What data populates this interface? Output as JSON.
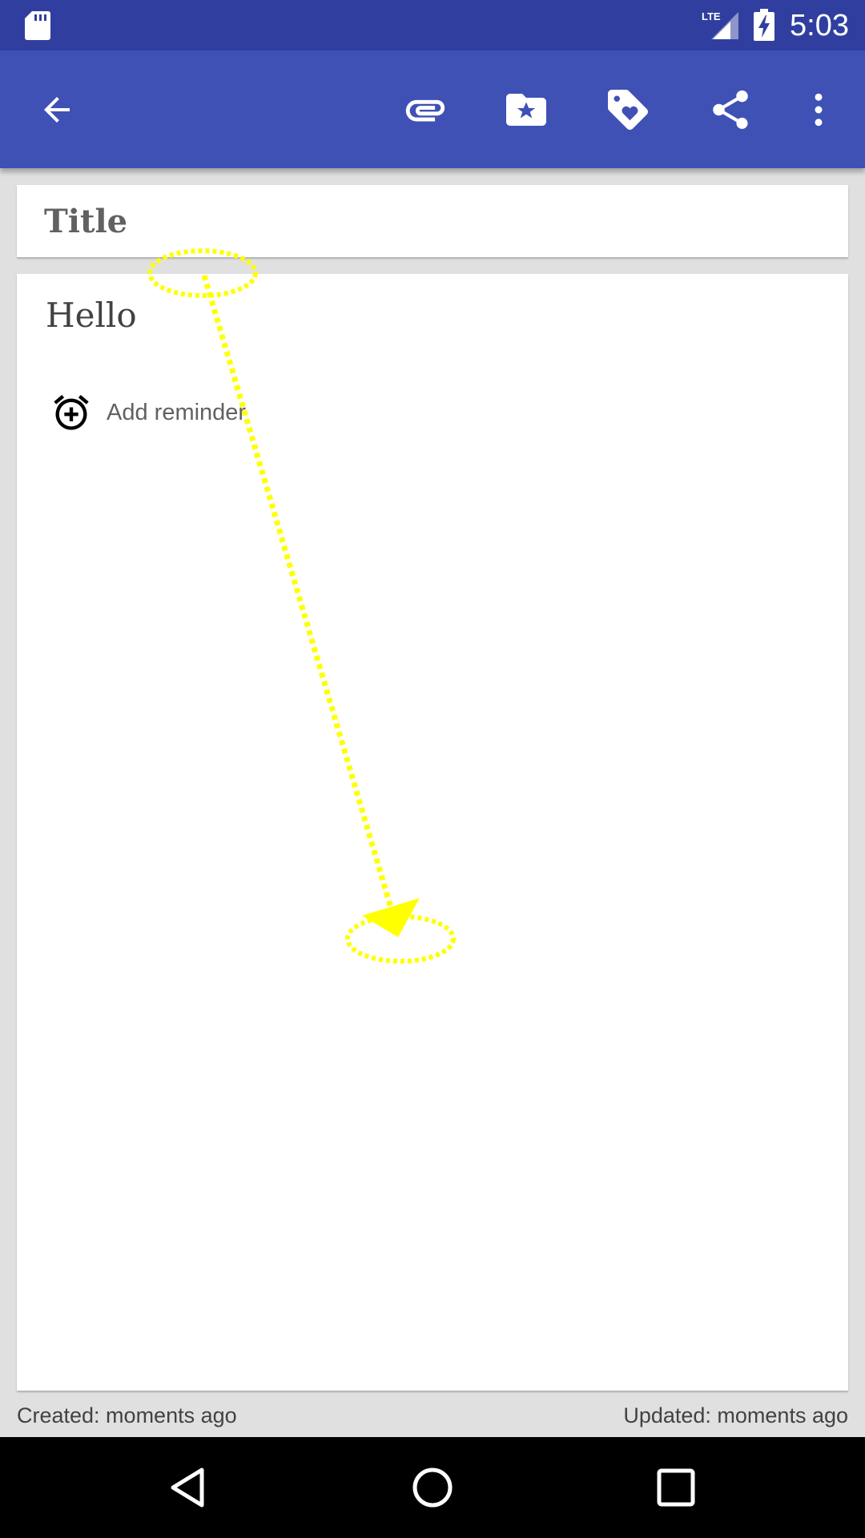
{
  "status_bar": {
    "time": "5:03",
    "network_label": "LTE",
    "icons": [
      "sd-card-icon",
      "lte-signal-icon",
      "battery-charging-icon"
    ]
  },
  "toolbar": {
    "back_icon": "arrow-back-icon",
    "actions": [
      "attachment-icon",
      "folder-star-icon",
      "tag-heart-icon",
      "share-icon",
      "more-vert-icon"
    ]
  },
  "note": {
    "title_placeholder": "Title",
    "body": "Hello",
    "reminder_label": "Add reminder",
    "reminder_icon": "alarm-add-icon"
  },
  "footer": {
    "created": "Created: moments ago",
    "updated": "Updated: moments ago"
  },
  "nav": {
    "icons": [
      "nav-back-icon",
      "nav-home-icon",
      "nav-recents-icon"
    ]
  },
  "colors": {
    "status_bar": "#303f9f",
    "app_bar": "#3f51b5",
    "background": "#e0e0e0",
    "gesture_overlay": "#ffff00"
  }
}
